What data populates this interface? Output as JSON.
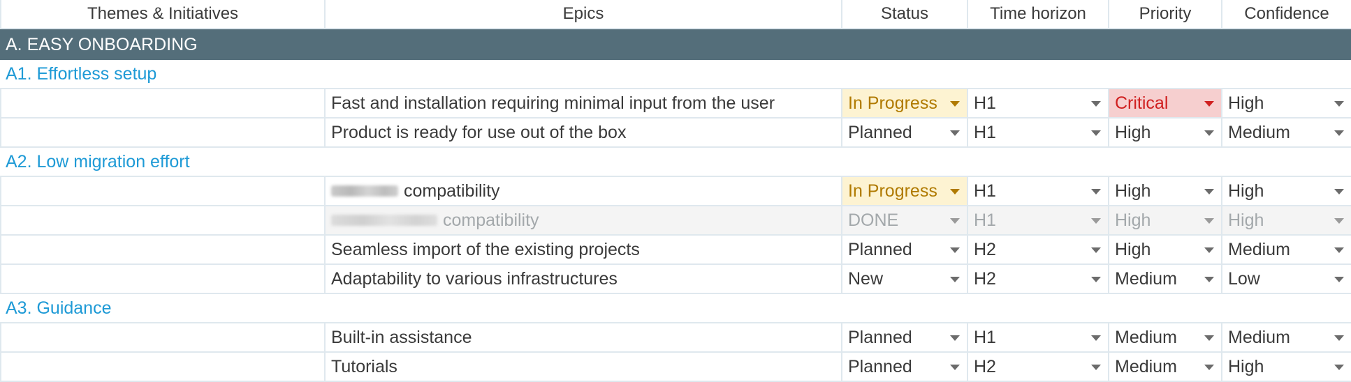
{
  "header": {
    "themes": "Themes & Initiatives",
    "epics": "Epics",
    "status": "Status",
    "time_horizon": "Time horizon",
    "priority": "Priority",
    "confidence": "Confidence"
  },
  "band": {
    "title": "A. EASY ONBOARDING",
    "color": "#546e7a"
  },
  "initiatives": [
    {
      "title": "A1. Effortless setup"
    },
    {
      "title": "A2. Low migration effort"
    },
    {
      "title": "A3. Guidance"
    }
  ],
  "rows": [
    {
      "epic": "Fast and installation requiring minimal input from the user",
      "status": "In Progress",
      "horizon": "H1",
      "priority": "Critical",
      "confidence": "High"
    },
    {
      "epic": "Product is ready for use out of the box",
      "status": "Planned",
      "horizon": "H1",
      "priority": "High",
      "confidence": "Medium"
    },
    {
      "epic": "compatibility",
      "status": "In Progress",
      "horizon": "H1",
      "priority": "High",
      "confidence": "High"
    },
    {
      "epic": "compatibility",
      "status": "DONE",
      "horizon": "H1",
      "priority": "High",
      "confidence": "High"
    },
    {
      "epic": "Seamless import of the existing projects",
      "status": "Planned",
      "horizon": "H2",
      "priority": "High",
      "confidence": "Medium"
    },
    {
      "epic": "Adaptability to various infrastructures",
      "status": "New",
      "horizon": "H2",
      "priority": "Medium",
      "confidence": "Low"
    },
    {
      "epic": "Built-in assistance",
      "status": "Planned",
      "horizon": "H1",
      "priority": "Medium",
      "confidence": "Medium"
    },
    {
      "epic": "Tutorials",
      "status": "Planned",
      "horizon": "H2",
      "priority": "Medium",
      "confidence": "High"
    }
  ],
  "colors": {
    "in_progress_bg": "#fdf3d2",
    "in_progress_text": "#b07a00",
    "critical_bg": "#f6cfcf",
    "critical_text": "#d02020",
    "initiative_text": "#1e9ad6"
  }
}
